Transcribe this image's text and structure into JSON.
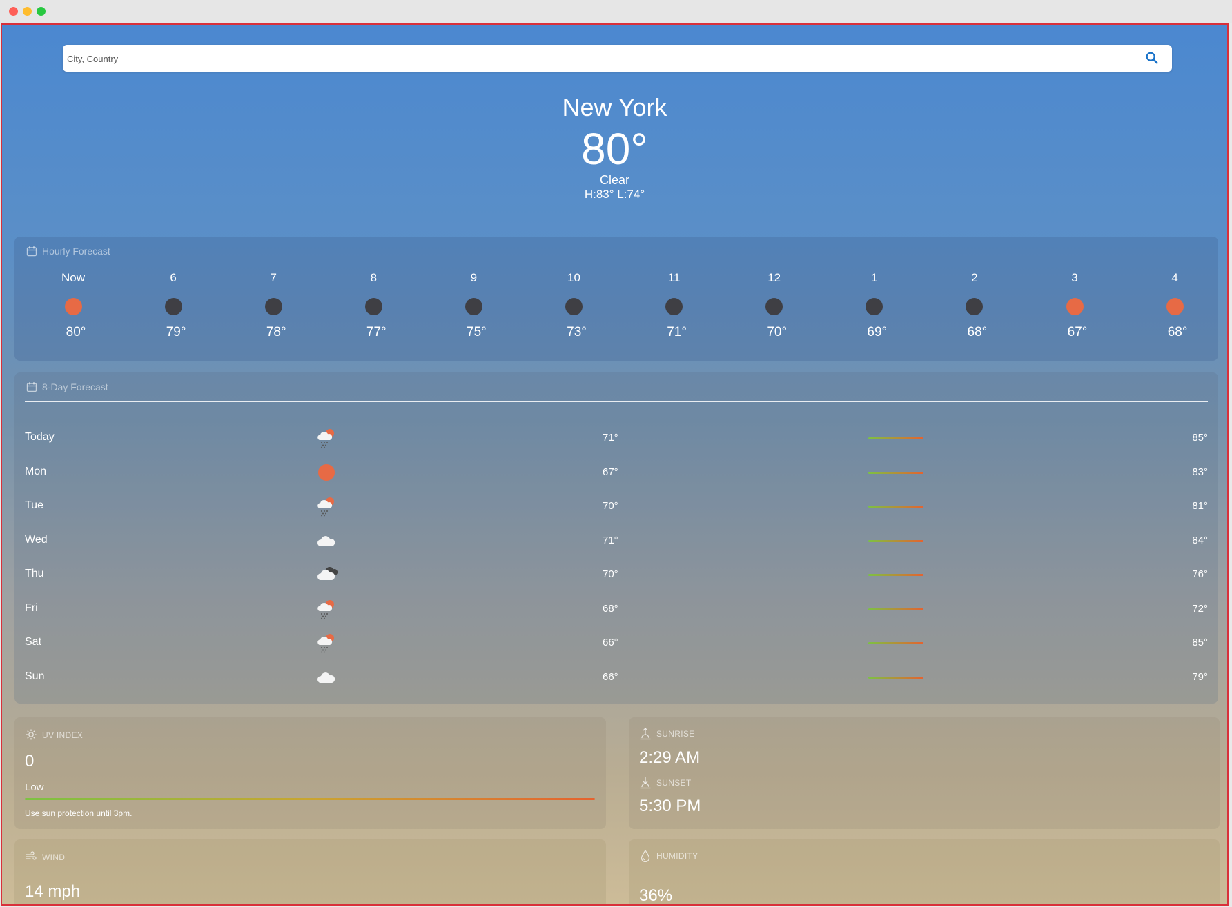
{
  "search": {
    "placeholder": "City, Country"
  },
  "current": {
    "city": "New York",
    "temp": "80°",
    "condition": "Clear",
    "hilo": "H:83° L:74°"
  },
  "hourly": {
    "title": "Hourly Forecast",
    "items": [
      {
        "time": "Now",
        "temp": "80°",
        "icon": "sun",
        "color": "#e76a45"
      },
      {
        "time": "6",
        "temp": "79°",
        "icon": "moon",
        "color": "#3f3f44"
      },
      {
        "time": "7",
        "temp": "78°",
        "icon": "moon",
        "color": "#3f3f44"
      },
      {
        "time": "8",
        "temp": "77°",
        "icon": "moon",
        "color": "#3f3f44"
      },
      {
        "time": "9",
        "temp": "75°",
        "icon": "moon",
        "color": "#3f3f44"
      },
      {
        "time": "10",
        "temp": "73°",
        "icon": "moon",
        "color": "#3f3f44"
      },
      {
        "time": "11",
        "temp": "71°",
        "icon": "moon",
        "color": "#3f3f44"
      },
      {
        "time": "12",
        "temp": "70°",
        "icon": "moon",
        "color": "#3f3f44"
      },
      {
        "time": "1",
        "temp": "69°",
        "icon": "moon",
        "color": "#3f3f44"
      },
      {
        "time": "2",
        "temp": "68°",
        "icon": "moon",
        "color": "#3f3f44"
      },
      {
        "time": "3",
        "temp": "67°",
        "icon": "sun",
        "color": "#e76a45"
      },
      {
        "time": "4",
        "temp": "68°",
        "icon": "sun",
        "color": "#e76a45"
      }
    ]
  },
  "daily": {
    "title": "8-Day Forecast",
    "items": [
      {
        "day": "Today",
        "icon": "rain-sun-icon",
        "lo": "71°",
        "hi": "85°"
      },
      {
        "day": "Mon",
        "icon": "sun-icon",
        "lo": "67°",
        "hi": "83°"
      },
      {
        "day": "Tue",
        "icon": "rain-sun-icon",
        "lo": "70°",
        "hi": "81°"
      },
      {
        "day": "Wed",
        "icon": "cloud-icon",
        "lo": "71°",
        "hi": "84°"
      },
      {
        "day": "Thu",
        "icon": "cloudy-icon",
        "lo": "70°",
        "hi": "76°"
      },
      {
        "day": "Fri",
        "icon": "rain-sun-icon",
        "lo": "68°",
        "hi": "72°"
      },
      {
        "day": "Sat",
        "icon": "rain-sun-icon",
        "lo": "66°",
        "hi": "85°"
      },
      {
        "day": "Sun",
        "icon": "cloud-icon",
        "lo": "66°",
        "hi": "79°"
      }
    ]
  },
  "uv": {
    "label": "UV INDEX",
    "value": "0",
    "level": "Low",
    "note": "Use sun protection until 3pm."
  },
  "sun": {
    "sunrise_label": "SUNRISE",
    "sunrise": "2:29 AM",
    "sunset_label": "SUNSET",
    "sunset": "5:30 PM"
  },
  "wind": {
    "label": "WIND",
    "value": "14 mph"
  },
  "humidity": {
    "label": "HUMIDITY",
    "value": "36%"
  }
}
